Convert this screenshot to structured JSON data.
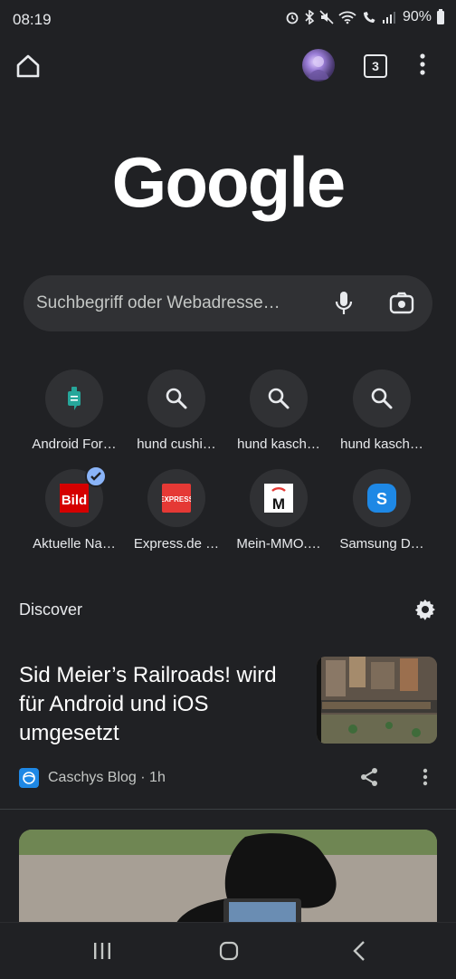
{
  "status": {
    "time": "08:19",
    "battery": "90%"
  },
  "toolbar": {
    "tab_count": "3"
  },
  "logo": {
    "text": "Google"
  },
  "search": {
    "placeholder": "Suchbegriff oder Webadresse…"
  },
  "shortcuts": [
    {
      "label": "Android For…",
      "icon": "android-forums-icon"
    },
    {
      "label": "hund cushi…",
      "icon": "search-icon"
    },
    {
      "label": "hund kasch…",
      "icon": "search-icon"
    },
    {
      "label": "hund kasch…",
      "icon": "search-icon"
    },
    {
      "label": "Aktuelle Na…",
      "icon": "bild-logo-icon",
      "logo_text": "Bild",
      "logo_color": "#d50000"
    },
    {
      "label": "Express.de …",
      "icon": "express-logo-icon",
      "logo_text": "EXPRESS",
      "logo_color": "#e53935"
    },
    {
      "label": "Mein-MMO.…",
      "icon": "mein-mmo-logo-icon",
      "logo_text": "M"
    },
    {
      "label": "Samsung D…",
      "icon": "samsung-logo-icon",
      "logo_text": "S",
      "logo_color": "#1e88e5"
    }
  ],
  "discover": {
    "heading": "Discover",
    "article": {
      "title": "Sid Meier’s Railroads! wird für Android und iOS umgesetzt",
      "source": "Caschys Blog · 1h"
    }
  },
  "colors": {
    "background": "#202124",
    "surface": "#303134",
    "text": "#e8eaed",
    "accent": "#8ab4f8"
  }
}
